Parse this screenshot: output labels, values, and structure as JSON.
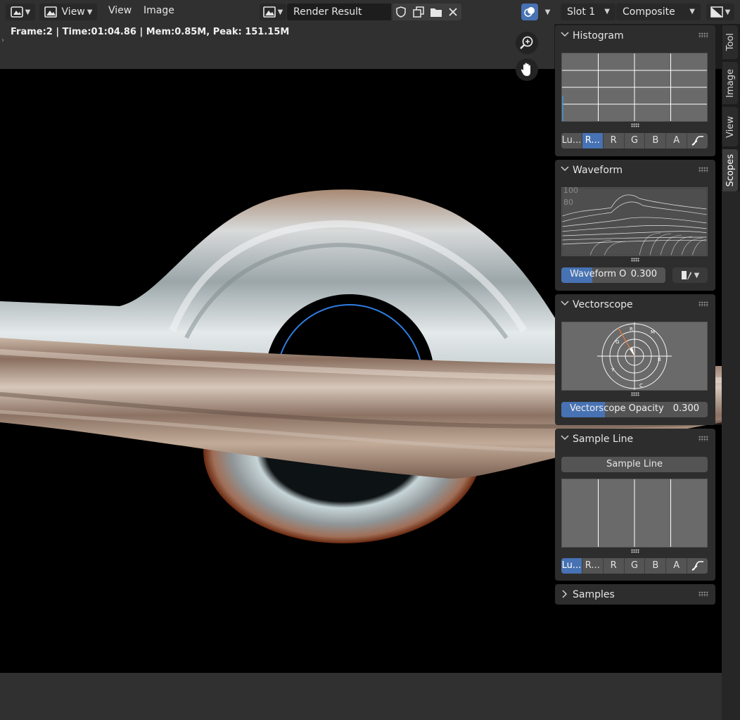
{
  "header": {
    "editor_type_icon": "image-editor-icon",
    "mode_icon": "image-mode-icon",
    "menu": [
      "View",
      "View",
      "Image"
    ],
    "image_name": "Render Result",
    "slot": "Slot 1",
    "pass": "Composite",
    "overlay_icon": "overlay-icon",
    "display_channels_icon": "display-channels-icon"
  },
  "stats": "Frame:2 | Time:01:04.86 | Mem:0.85M, Peak: 151.15M",
  "side_tabs": [
    "Tool",
    "Image",
    "View",
    "Scopes"
  ],
  "active_tab": "Scopes",
  "histogram": {
    "title": "Histogram",
    "channels": [
      "Lu...",
      "R...",
      "R",
      "G",
      "B",
      "A"
    ],
    "active_channel": 1
  },
  "waveform": {
    "title": "Waveform",
    "scale_labels": [
      "100",
      "80"
    ],
    "opacity_label": "Waveform O",
    "opacity_value": "0.300",
    "opacity": 0.3
  },
  "vectorscope": {
    "title": "Vectorscope",
    "opacity_label": "Vectorscope Opacity",
    "opacity_value": "0.300",
    "opacity": 0.3
  },
  "sample_line": {
    "title": "Sample Line",
    "button": "Sample Line",
    "channels": [
      "Lu...",
      "R...",
      "R",
      "G",
      "B",
      "A"
    ],
    "active_channel": 0
  },
  "samples": {
    "title": "Samples"
  },
  "colors": {
    "accent": "#4772b3",
    "panel": "#2d2d2d",
    "header": "#303030"
  }
}
